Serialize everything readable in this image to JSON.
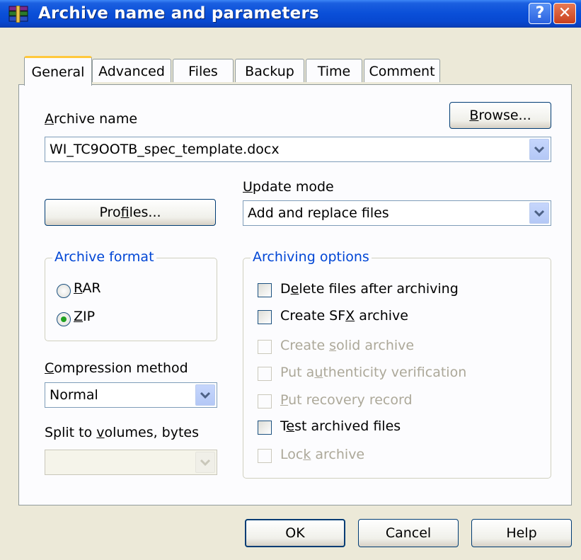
{
  "window": {
    "title": "Archive name and parameters",
    "help_glyph": "?",
    "close_glyph": "✕",
    "app_icon": "winrar-books-icon"
  },
  "tabs": [
    {
      "label": "General",
      "active": true
    },
    {
      "label": "Advanced",
      "active": false
    },
    {
      "label": "Files",
      "active": false
    },
    {
      "label": "Backup",
      "active": false
    },
    {
      "label": "Time",
      "active": false
    },
    {
      "label": "Comment",
      "active": false
    }
  ],
  "general": {
    "archive_name_label_a": "A",
    "archive_name_label_rest": "rchive name",
    "archive_name_value": "WI_TC9OOTB_spec_template.docx",
    "browse_label_a": "B",
    "browse_label_rest": "rowse...",
    "profiles_label_a": "Pro",
    "profiles_label_u": "f",
    "profiles_label_rest": "iles...",
    "update_mode_label_a": "U",
    "update_mode_label_rest": "pdate mode",
    "update_mode_value": "Add and replace files",
    "archive_format": {
      "legend": "Archive format",
      "options": [
        {
          "label_u": "R",
          "label_rest": "AR",
          "selected": false
        },
        {
          "label_u": "Z",
          "label_rest": "IP",
          "selected": true
        }
      ]
    },
    "compression_label_a": "C",
    "compression_label_rest": "ompression method",
    "compression_value": "Normal",
    "split_label_pre": "Split to ",
    "split_label_u": "v",
    "split_label_rest": "olumes, bytes",
    "split_value": "",
    "archiving_options": {
      "legend": "Archiving options",
      "items": [
        {
          "pre": "D",
          "u": "e",
          "post": "lete files after archiving",
          "checked": false,
          "enabled": true
        },
        {
          "pre": "Create SF",
          "u": "X",
          "post": " archive",
          "checked": false,
          "enabled": true
        },
        {
          "pre": "Create ",
          "u": "s",
          "post": "olid archive",
          "checked": false,
          "enabled": false
        },
        {
          "pre": "Put a",
          "u": "u",
          "post": "thenticity verification",
          "checked": false,
          "enabled": false
        },
        {
          "pre": "",
          "u": "P",
          "post": "ut recovery record",
          "checked": false,
          "enabled": false
        },
        {
          "pre": "T",
          "u": "e",
          "post": "st archived files",
          "checked": false,
          "enabled": true
        },
        {
          "pre": "Loc",
          "u": "k",
          "post": " archive",
          "checked": false,
          "enabled": false
        }
      ]
    }
  },
  "buttons": {
    "ok": "OK",
    "cancel": "Cancel",
    "help": "Help"
  }
}
